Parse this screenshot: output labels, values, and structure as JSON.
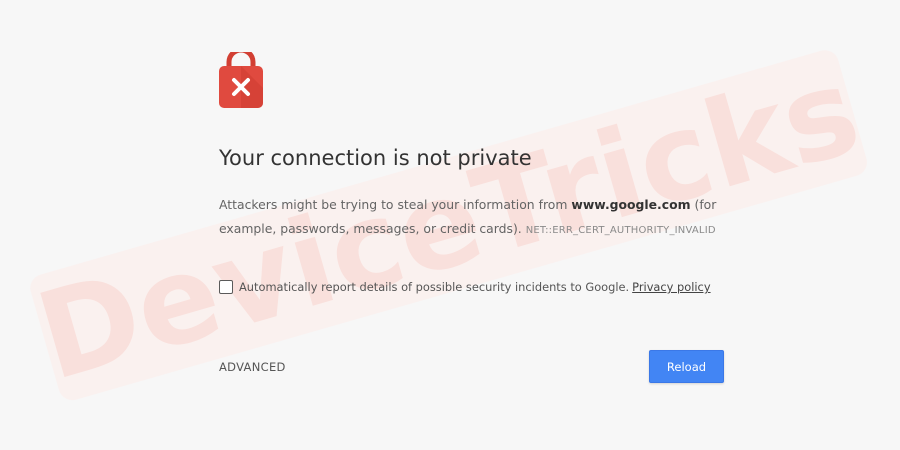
{
  "watermark": {
    "text": "DeviceTricks"
  },
  "icon": {
    "name": "lock-x-icon",
    "color": "#e04a3f"
  },
  "heading": "Your connection is not private",
  "message": {
    "intro": "Attackers might be trying to steal your information from ",
    "domain": "www.google.com",
    "rest": " (for example, passwords, messages, or credit cards). ",
    "error_code": "NET::ERR_CERT_AUTHORITY_INVALID"
  },
  "report": {
    "label": "Automatically report details of possible security incidents to Google.",
    "link": "Privacy policy"
  },
  "advanced_label": "ADVANCED",
  "reload_label": "Reload",
  "colors": {
    "accent": "#4285f4",
    "background": "#f7f7f7"
  }
}
